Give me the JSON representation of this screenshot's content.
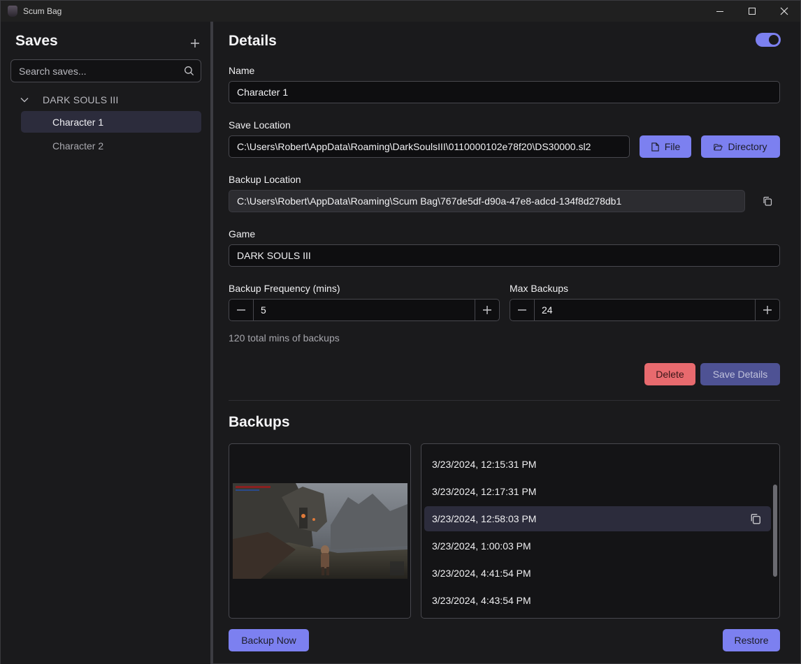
{
  "window": {
    "title": "Scum Bag"
  },
  "sidebar": {
    "title": "Saves",
    "add_icon": "plus-icon",
    "search": {
      "placeholder": "Search saves...",
      "value": ""
    },
    "games": [
      {
        "label": "DARK SOULS III",
        "expanded": true,
        "saves": [
          {
            "label": "Character 1",
            "selected": true
          },
          {
            "label": "Character 2",
            "selected": false
          }
        ]
      }
    ]
  },
  "details": {
    "title": "Details",
    "toggle_on": true,
    "name": {
      "label": "Name",
      "value": "Character 1"
    },
    "save_location": {
      "label": "Save Location",
      "value": "C:\\Users\\Robert\\AppData\\Roaming\\DarkSoulsIII\\0110000102e78f20\\DS30000.sl2",
      "file_button": "File",
      "directory_button": "Directory"
    },
    "backup_location": {
      "label": "Backup Location",
      "value": "C:\\Users\\Robert\\AppData\\Roaming\\Scum Bag\\767de5df-d90a-47e8-adcd-134f8d278db1"
    },
    "game": {
      "label": "Game",
      "value": "DARK SOULS III"
    },
    "backup_frequency": {
      "label": "Backup Frequency (mins)",
      "value": "5"
    },
    "max_backups": {
      "label": "Max Backups",
      "value": "24"
    },
    "summary": "120 total mins of backups",
    "delete_button": "Delete",
    "save_button": "Save Details"
  },
  "backups": {
    "title": "Backups",
    "items": [
      {
        "label": "3/23/2024, 12:15:31 PM",
        "selected": false
      },
      {
        "label": "3/23/2024, 12:17:31 PM",
        "selected": false
      },
      {
        "label": "3/23/2024, 12:58:03 PM",
        "selected": true
      },
      {
        "label": "3/23/2024, 1:00:03 PM",
        "selected": false
      },
      {
        "label": "3/23/2024, 4:41:54 PM",
        "selected": false
      },
      {
        "label": "3/23/2024, 4:43:54 PM",
        "selected": false
      }
    ],
    "backup_now_button": "Backup Now",
    "restore_button": "Restore"
  },
  "colors": {
    "accent": "#7c80f0",
    "danger": "#e86a6e",
    "background": "#1a1a1c",
    "selection": "#2c2c3c"
  }
}
